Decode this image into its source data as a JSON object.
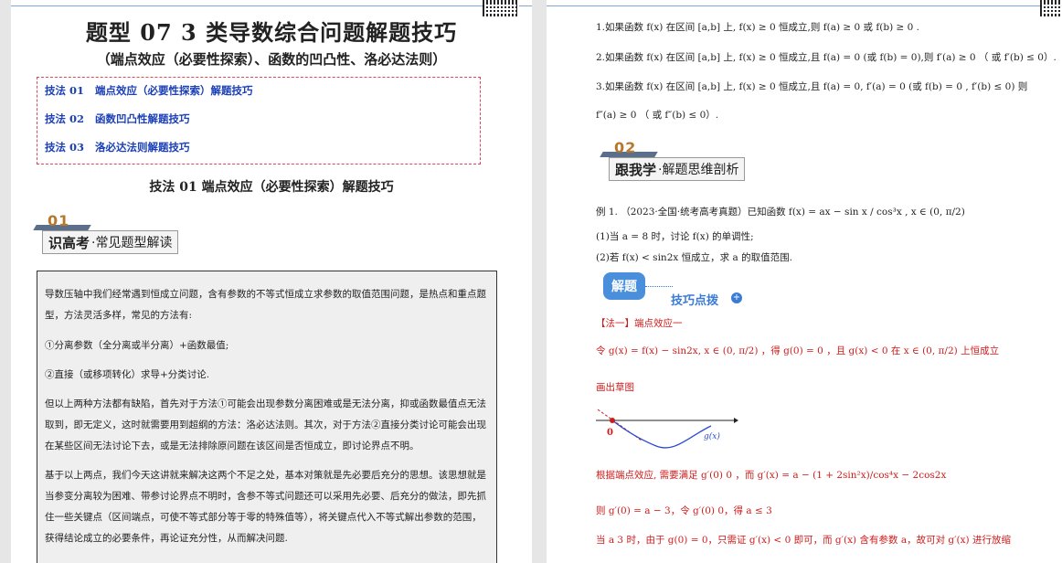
{
  "left": {
    "title": "题型 07 3 类导数综合问题解题技巧",
    "subtitle": "（端点效应（必要性探索）、函数的凹凸性、洛必达法则）",
    "toc": [
      {
        "label": "技法 01",
        "text": "端点效应（必要性探索）解题技巧"
      },
      {
        "label": "技法 02",
        "text": "函数凹凸性解题技巧"
      },
      {
        "label": "技法 03",
        "text": "洛必达法则解题技巧"
      }
    ],
    "section_heading": "技法 01  端点效应（必要性探索）解题技巧",
    "badge": {
      "num": "01",
      "bold": "识高考",
      "rest": "·常见题型解读"
    },
    "paragraphs": [
      "导数压轴中我们经常遇到恒成立问题，含有参数的不等式恒成立求参数的取值范围问题，是热点和重点题型，方法灵活多样，常见的方法有:",
      "①分离参数（全分离或半分离）+函数最值;",
      "②直接（或移项转化）求导+分类讨论.",
      "但以上两种方法都有缺陷，首先对于方法①可能会出现参数分离困难或是无法分离，抑或函数最值点无法取到，即无定义，这时就需要用到超纲的方法：洛必达法则。其次，对于方法②直接分类讨论可能会出现在某些区间无法讨论下去，或是无法排除原问题在该区间是否恒成立，即讨论界点不明。",
      "基于以上两点，我们今天这讲就来解决这两个不足之处，基本对策就是先必要后充分的思想。该思想就是当参变分离较为困难、带参讨论界点不明时，含参不等式问题还可以采用先必要、后充分的做法，即先抓住一些关键点（区间端点，可使不等式部分等于零的特殊值等），将关键点代入不等式解出参数的范围，获得结论成立的必要条件，再论证充分性，从而解决问题."
    ]
  },
  "right": {
    "rules": [
      "1.如果函数 f(x) 在区间 [a,b] 上, f(x) ≥ 0 恒成立,则 f(a) ≥ 0 或 f(b) ≥ 0 .",
      "2.如果函数 f(x) 在区间 [a,b] 上, f(x) ≥ 0 恒成立,且 f(a) = 0 (或 f(b) = 0),则 f′(a) ≥ 0 （ 或 f′(b) ≤ 0）.",
      "3.如果函数 f(x) 在区间 [a,b] 上, f(x) ≥ 0 恒成立,且 f(a) = 0, f′(a) = 0 (或 f(b) = 0 , f′(b) ≤ 0)   则",
      "f″(a) ≥ 0 （ 或 f″(b) ≤ 0）."
    ],
    "badge": {
      "num": "02",
      "bold": "跟我学",
      "rest": "·解题思维剖析"
    },
    "example": "例 1.  （2023·全国·统考高考真题）已知函数 f(x) = ax − sin x / cos³x , x ∈ (0, π/2)",
    "q1": "(1)当 a = 8 时，讨论 f(x) 的单调性;",
    "q2": "(2)若 f(x) < sin2x 恒成立，求 a 的取值范围.",
    "jiexi": "解题",
    "jiqiao": "技巧点拨",
    "method": "【法一】端点效应一",
    "line1": "令  g(x) = f(x) − sin2x, x ∈ (0, π/2)  ，得  g(0) = 0 ，且  g(x) < 0  在  x ∈ (0, π/2)  上恒成立",
    "draw_sketch": "画出草图",
    "sketch_zero": "0",
    "sketch_label": "g(x)",
    "line2": "根据端点效应, 需要满足 g′(0)  0 ，而  g′(x) = a − (1 + 2sin²x)/cos⁴x − 2cos2x",
    "line3": "则  g′(0) = a − 3，令  g′(0)  0，得 a ≤ 3",
    "line4": "当  a  3  时，由于  g(0) = 0，只需证  g′(x) < 0  即可，而  g′(x)  含有参数  a，故可对  g′(x)  进行放缩"
  },
  "colors": {
    "toc_text": "#1a3fb8",
    "toc_border": "#e0465a",
    "red": "#d01a1a",
    "badge_num": "#b8772a"
  }
}
